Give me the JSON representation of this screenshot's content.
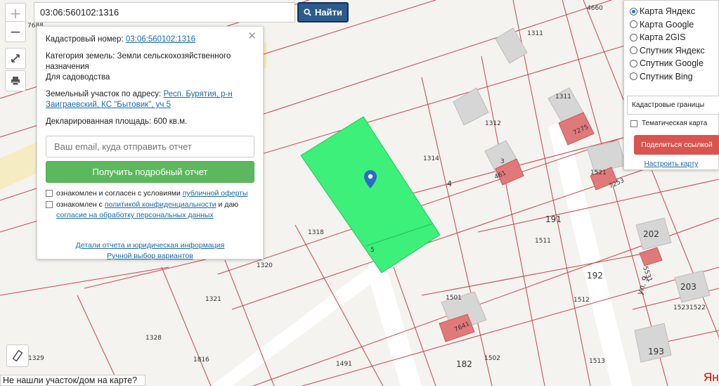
{
  "search": {
    "value": "03:06:560102:1316",
    "button_label": "Найти"
  },
  "tools": {
    "zoom_in": "+",
    "zoom_out": "−"
  },
  "popup": {
    "cad_label": "Кадастровый номер:",
    "cad_number": "03:06:560102:1316",
    "category_label": "Категория земель:",
    "category_value": "Земли сельскохозяйственного назначения",
    "use_value": "Для садоводства",
    "address_label": "Земельный участок по адресу:",
    "address_value": "Респ. Бурятия, р-н Заиграевский, КС \"Бытовик\", уч 5",
    "area_label": "Декларированная площадь:",
    "area_value": "600 кв.м.",
    "email_placeholder": "Ваш email, куда отправить отчет",
    "report_button": "Получить подробный отчет",
    "consent1_text": "ознакомлен и согласен с условиями",
    "consent1_link": "публичной оферты",
    "consent2_text": "ознакомлен с",
    "consent2_link1": "политикой конфиденциальности",
    "consent2_mid": "и даю",
    "consent2_link2": "согласие на обработку персональных данных",
    "details_link": "Детали отчета и юридическая информация",
    "manual_link": "Ручной выбор вариантов"
  },
  "layers": {
    "options": [
      {
        "label": "Карта Яндекс",
        "selected": true
      },
      {
        "label": "Карта Google",
        "selected": false
      },
      {
        "label": "Карта 2GIS",
        "selected": false
      },
      {
        "label": "Спутник Яндекс",
        "selected": false
      },
      {
        "label": "Спутник Google",
        "selected": false
      },
      {
        "label": "Спутник Bing",
        "selected": false
      }
    ],
    "cadastral_select": "Кадастровые границы",
    "thematic_label": "Тематическая карта",
    "share_button": "Поделиться ссылкой",
    "setup_link": "Настроить карту"
  },
  "map": {
    "plot_labels": [
      "1311",
      "1311",
      "4660",
      "1312",
      "1314",
      "4",
      "7275",
      "1521",
      "7253",
      "191",
      "1511",
      "202",
      "5531",
      "192",
      "1512",
      "203",
      "15231522",
      "193",
      "1513",
      "182",
      "1502",
      "1501",
      "7641",
      "1318",
      "1320",
      "1321",
      "1328",
      "1329",
      "1816",
      "1491",
      "7688",
      "461",
      "5",
      "3",
      "ул. 9"
    ],
    "highlight_color": "#3cf07a",
    "building_red": "#e07a7a"
  },
  "notfound_label": "Не нашли участок/дом на карте?",
  "yandex_logo": "Янд"
}
